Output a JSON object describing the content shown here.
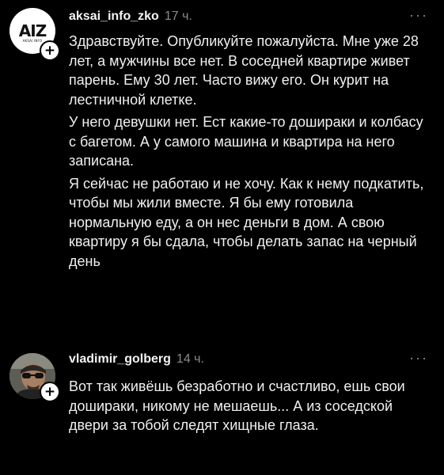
{
  "comments": [
    {
      "username": "aksai_info_zko",
      "time": "17 ч.",
      "avatar_text": "AIZ",
      "avatar_subtext": "AKSAI INFO",
      "add_glyph": "+",
      "more_glyph": "···",
      "paragraphs": [
        "Здравствуйте. Опубликуйте пожалуйста. Мне уже 28 лет, а мужчины все нет. В соседней квартире живет парень. Ему 30 лет. Часто вижу его. Он курит на лестничной клетке.",
        "У него девушки нет. Ест какие-то дошираки и колбасу с багетом. А у самого машина и квартира на него записана.",
        "Я сейчас не работаю и не хочу. Как к нему подкатить, чтобы мы жили вместе. Я бы ему готовила нормальную еду, а он нес деньги в дом. А свою квартиру я бы сдала, чтобы делать запас на черный день"
      ]
    },
    {
      "username": "vladimir_golberg",
      "time": "14 ч.",
      "add_glyph": "+",
      "more_glyph": "···",
      "paragraphs": [
        "Вот так живёшь безработно и счастливо, ешь свои дошираки, никому не мешаешь... А из соседской двери за тобой следят хищные глаза."
      ]
    }
  ],
  "colors": {
    "background": "#000000",
    "text": "#f0f0f0",
    "muted": "#8c8c8c"
  }
}
